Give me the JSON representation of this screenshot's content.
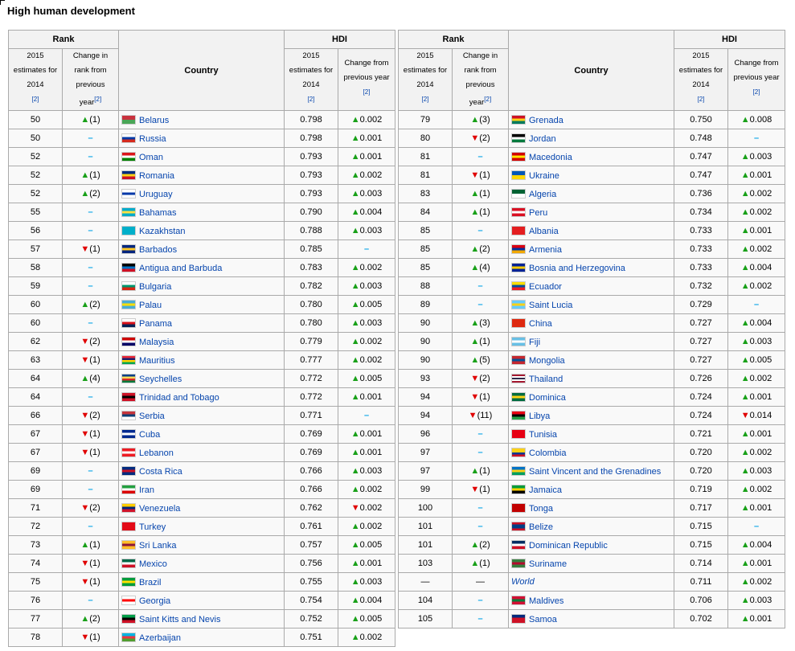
{
  "heading": "High human development",
  "header": {
    "rank": "Rank",
    "hdi": "HDI",
    "country": "Country",
    "estimates": "2015 estimates for 2014",
    "rank_change": "Change in rank from previous year",
    "hdi_change": "Change from previous year",
    "ref": "[2]"
  },
  "left_rows": [
    {
      "rank": "50",
      "rank_change": {
        "dir": "up",
        "value": "(1)"
      },
      "country": "Belarus",
      "flag": [
        "#c8313e",
        "#4aa657"
      ],
      "hdi": "0.798",
      "hdi_change": {
        "dir": "up",
        "value": "0.002"
      }
    },
    {
      "rank": "50",
      "rank_change": {
        "dir": "same",
        "value": ""
      },
      "country": "Russia",
      "flag": [
        "#ffffff",
        "#0039a6",
        "#d52b1e"
      ],
      "hdi": "0.798",
      "hdi_change": {
        "dir": "up",
        "value": "0.001"
      }
    },
    {
      "rank": "52",
      "rank_change": {
        "dir": "same",
        "value": ""
      },
      "country": "Oman",
      "flag": [
        "#db161b",
        "#ffffff",
        "#008000"
      ],
      "hdi": "0.793",
      "hdi_change": {
        "dir": "up",
        "value": "0.001"
      }
    },
    {
      "rank": "52",
      "rank_change": {
        "dir": "up",
        "value": "(1)"
      },
      "country": "Romania",
      "flag": [
        "#002b7f",
        "#fcd116",
        "#ce1126"
      ],
      "hdi": "0.793",
      "hdi_change": {
        "dir": "up",
        "value": "0.002"
      }
    },
    {
      "rank": "52",
      "rank_change": {
        "dir": "up",
        "value": "(2)"
      },
      "country": "Uruguay",
      "flag": [
        "#ffffff",
        "#0038a8",
        "#ffffff"
      ],
      "hdi": "0.793",
      "hdi_change": {
        "dir": "up",
        "value": "0.003"
      }
    },
    {
      "rank": "55",
      "rank_change": {
        "dir": "same",
        "value": ""
      },
      "country": "Bahamas",
      "flag": [
        "#00abc9",
        "#fae042",
        "#00abc9"
      ],
      "hdi": "0.790",
      "hdi_change": {
        "dir": "up",
        "value": "0.004"
      }
    },
    {
      "rank": "56",
      "rank_change": {
        "dir": "same",
        "value": ""
      },
      "country": "Kazakhstan",
      "flag": [
        "#00afca",
        "#00afca"
      ],
      "hdi": "0.788",
      "hdi_change": {
        "dir": "up",
        "value": "0.003"
      }
    },
    {
      "rank": "57",
      "rank_change": {
        "dir": "down",
        "value": "(1)"
      },
      "country": "Barbados",
      "flag": [
        "#00267f",
        "#ffc726",
        "#00267f"
      ],
      "hdi": "0.785",
      "hdi_change": {
        "dir": "same",
        "value": ""
      }
    },
    {
      "rank": "58",
      "rank_change": {
        "dir": "same",
        "value": ""
      },
      "country": "Antigua and Barbuda",
      "flag": [
        "#000000",
        "#0072c6",
        "#ce1126"
      ],
      "hdi": "0.783",
      "hdi_change": {
        "dir": "up",
        "value": "0.002"
      }
    },
    {
      "rank": "59",
      "rank_change": {
        "dir": "same",
        "value": ""
      },
      "country": "Bulgaria",
      "flag": [
        "#ffffff",
        "#00966e",
        "#d62612"
      ],
      "hdi": "0.782",
      "hdi_change": {
        "dir": "up",
        "value": "0.003"
      }
    },
    {
      "rank": "60",
      "rank_change": {
        "dir": "up",
        "value": "(2)"
      },
      "country": "Palau",
      "flag": [
        "#4aadd6",
        "#ffde00",
        "#4aadd6"
      ],
      "hdi": "0.780",
      "hdi_change": {
        "dir": "up",
        "value": "0.005"
      }
    },
    {
      "rank": "60",
      "rank_change": {
        "dir": "same",
        "value": ""
      },
      "country": "Panama",
      "flag": [
        "#ffffff",
        "#da121a",
        "#072357"
      ],
      "hdi": "0.780",
      "hdi_change": {
        "dir": "up",
        "value": "0.003"
      }
    },
    {
      "rank": "62",
      "rank_change": {
        "dir": "down",
        "value": "(2)"
      },
      "country": "Malaysia",
      "flag": [
        "#cc0001",
        "#ffffff",
        "#010066"
      ],
      "hdi": "0.779",
      "hdi_change": {
        "dir": "up",
        "value": "0.002"
      }
    },
    {
      "rank": "63",
      "rank_change": {
        "dir": "down",
        "value": "(1)"
      },
      "country": "Mauritius",
      "flag": [
        "#ea2839",
        "#1a206d",
        "#ffd500",
        "#00a551"
      ],
      "hdi": "0.777",
      "hdi_change": {
        "dir": "up",
        "value": "0.002"
      }
    },
    {
      "rank": "64",
      "rank_change": {
        "dir": "up",
        "value": "(4)"
      },
      "country": "Seychelles",
      "flag": [
        "#003f87",
        "#fcd856",
        "#d62828",
        "#007a3d"
      ],
      "hdi": "0.772",
      "hdi_change": {
        "dir": "up",
        "value": "0.005"
      }
    },
    {
      "rank": "64",
      "rank_change": {
        "dir": "same",
        "value": ""
      },
      "country": "Trinidad and Tobago",
      "flag": [
        "#ce1126",
        "#000000",
        "#ce1126"
      ],
      "hdi": "0.772",
      "hdi_change": {
        "dir": "up",
        "value": "0.001"
      }
    },
    {
      "rank": "66",
      "rank_change": {
        "dir": "down",
        "value": "(2)"
      },
      "country": "Serbia",
      "flag": [
        "#c6363c",
        "#0c4076",
        "#ffffff"
      ],
      "hdi": "0.771",
      "hdi_change": {
        "dir": "same",
        "value": ""
      }
    },
    {
      "rank": "67",
      "rank_change": {
        "dir": "down",
        "value": "(1)"
      },
      "country": "Cuba",
      "flag": [
        "#002a8f",
        "#ffffff",
        "#002a8f"
      ],
      "hdi": "0.769",
      "hdi_change": {
        "dir": "up",
        "value": "0.001"
      }
    },
    {
      "rank": "67",
      "rank_change": {
        "dir": "down",
        "value": "(1)"
      },
      "country": "Lebanon",
      "flag": [
        "#ed1c24",
        "#ffffff",
        "#ed1c24"
      ],
      "hdi": "0.769",
      "hdi_change": {
        "dir": "up",
        "value": "0.001"
      }
    },
    {
      "rank": "69",
      "rank_change": {
        "dir": "same",
        "value": ""
      },
      "country": "Costa Rica",
      "flag": [
        "#002b7f",
        "#ce1126",
        "#002b7f"
      ],
      "hdi": "0.766",
      "hdi_change": {
        "dir": "up",
        "value": "0.003"
      }
    },
    {
      "rank": "69",
      "rank_change": {
        "dir": "same",
        "value": ""
      },
      "country": "Iran",
      "flag": [
        "#239f40",
        "#ffffff",
        "#da0000"
      ],
      "hdi": "0.766",
      "hdi_change": {
        "dir": "up",
        "value": "0.002"
      }
    },
    {
      "rank": "71",
      "rank_change": {
        "dir": "down",
        "value": "(2)"
      },
      "country": "Venezuela",
      "flag": [
        "#ffcc00",
        "#00247d",
        "#cf142b"
      ],
      "hdi": "0.762",
      "hdi_change": {
        "dir": "down",
        "value": "0.002"
      }
    },
    {
      "rank": "72",
      "rank_change": {
        "dir": "same",
        "value": ""
      },
      "country": "Turkey",
      "flag": [
        "#e30a17",
        "#e30a17"
      ],
      "hdi": "0.761",
      "hdi_change": {
        "dir": "up",
        "value": "0.002"
      }
    },
    {
      "rank": "73",
      "rank_change": {
        "dir": "up",
        "value": "(1)"
      },
      "country": "Sri Lanka",
      "flag": [
        "#ffbe29",
        "#8d153a",
        "#ffbe29"
      ],
      "hdi": "0.757",
      "hdi_change": {
        "dir": "up",
        "value": "0.005"
      }
    },
    {
      "rank": "74",
      "rank_change": {
        "dir": "down",
        "value": "(1)"
      },
      "country": "Mexico",
      "flag": [
        "#006847",
        "#ffffff",
        "#ce1126"
      ],
      "hdi": "0.756",
      "hdi_change": {
        "dir": "up",
        "value": "0.001"
      }
    },
    {
      "rank": "75",
      "rank_change": {
        "dir": "down",
        "value": "(1)"
      },
      "country": "Brazil",
      "flag": [
        "#009c3b",
        "#ffdf00",
        "#009c3b"
      ],
      "hdi": "0.755",
      "hdi_change": {
        "dir": "up",
        "value": "0.003"
      }
    },
    {
      "rank": "76",
      "rank_change": {
        "dir": "same",
        "value": ""
      },
      "country": "Georgia",
      "flag": [
        "#ffffff",
        "#ff0000",
        "#ffffff"
      ],
      "hdi": "0.754",
      "hdi_change": {
        "dir": "up",
        "value": "0.004"
      }
    },
    {
      "rank": "77",
      "rank_change": {
        "dir": "up",
        "value": "(2)"
      },
      "country": "Saint Kitts and Nevis",
      "flag": [
        "#009e49",
        "#000000",
        "#ce1126"
      ],
      "hdi": "0.752",
      "hdi_change": {
        "dir": "up",
        "value": "0.005"
      }
    },
    {
      "rank": "78",
      "rank_change": {
        "dir": "down",
        "value": "(1)"
      },
      "country": "Azerbaijan",
      "flag": [
        "#00b5e2",
        "#ef3340",
        "#509e2f"
      ],
      "hdi": "0.751",
      "hdi_change": {
        "dir": "up",
        "value": "0.002"
      }
    }
  ],
  "right_rows": [
    {
      "rank": "79",
      "rank_change": {
        "dir": "up",
        "value": "(3)"
      },
      "country": "Grenada",
      "flag": [
        "#ce1126",
        "#fcd116",
        "#007a5e"
      ],
      "hdi": "0.750",
      "hdi_change": {
        "dir": "up",
        "value": "0.008"
      }
    },
    {
      "rank": "80",
      "rank_change": {
        "dir": "down",
        "value": "(2)"
      },
      "country": "Jordan",
      "flag": [
        "#000000",
        "#ffffff",
        "#007a3d"
      ],
      "hdi": "0.748",
      "hdi_change": {
        "dir": "same",
        "value": ""
      }
    },
    {
      "rank": "81",
      "rank_change": {
        "dir": "same",
        "value": ""
      },
      "country": "Macedonia",
      "flag": [
        "#d20000",
        "#ffe600",
        "#d20000"
      ],
      "hdi": "0.747",
      "hdi_change": {
        "dir": "up",
        "value": "0.003"
      }
    },
    {
      "rank": "81",
      "rank_change": {
        "dir": "down",
        "value": "(1)"
      },
      "country": "Ukraine",
      "flag": [
        "#0057b7",
        "#ffd700"
      ],
      "hdi": "0.747",
      "hdi_change": {
        "dir": "up",
        "value": "0.001"
      }
    },
    {
      "rank": "83",
      "rank_change": {
        "dir": "up",
        "value": "(1)"
      },
      "country": "Algeria",
      "flag": [
        "#006233",
        "#ffffff"
      ],
      "hdi": "0.736",
      "hdi_change": {
        "dir": "up",
        "value": "0.002"
      }
    },
    {
      "rank": "84",
      "rank_change": {
        "dir": "up",
        "value": "(1)"
      },
      "country": "Peru",
      "flag": [
        "#d91023",
        "#ffffff",
        "#d91023"
      ],
      "hdi": "0.734",
      "hdi_change": {
        "dir": "up",
        "value": "0.002"
      }
    },
    {
      "rank": "85",
      "rank_change": {
        "dir": "same",
        "value": ""
      },
      "country": "Albania",
      "flag": [
        "#e41e20",
        "#e41e20"
      ],
      "hdi": "0.733",
      "hdi_change": {
        "dir": "up",
        "value": "0.001"
      }
    },
    {
      "rank": "85",
      "rank_change": {
        "dir": "up",
        "value": "(2)"
      },
      "country": "Armenia",
      "flag": [
        "#d90012",
        "#0033a0",
        "#f2a800"
      ],
      "hdi": "0.733",
      "hdi_change": {
        "dir": "up",
        "value": "0.002"
      }
    },
    {
      "rank": "85",
      "rank_change": {
        "dir": "up",
        "value": "(4)"
      },
      "country": "Bosnia and Herzegovina",
      "flag": [
        "#002395",
        "#fecb00",
        "#002395"
      ],
      "hdi": "0.733",
      "hdi_change": {
        "dir": "up",
        "value": "0.004"
      }
    },
    {
      "rank": "88",
      "rank_change": {
        "dir": "same",
        "value": ""
      },
      "country": "Ecuador",
      "flag": [
        "#ffdd00",
        "#034ea2",
        "#ed1c24"
      ],
      "hdi": "0.732",
      "hdi_change": {
        "dir": "up",
        "value": "0.002"
      }
    },
    {
      "rank": "89",
      "rank_change": {
        "dir": "same",
        "value": ""
      },
      "country": "Saint Lucia",
      "flag": [
        "#66ccff",
        "#fcd116",
        "#66ccff"
      ],
      "hdi": "0.729",
      "hdi_change": {
        "dir": "same",
        "value": ""
      }
    },
    {
      "rank": "90",
      "rank_change": {
        "dir": "up",
        "value": "(3)"
      },
      "country": "China",
      "flag": [
        "#de2910",
        "#de2910"
      ],
      "hdi": "0.727",
      "hdi_change": {
        "dir": "up",
        "value": "0.004"
      }
    },
    {
      "rank": "90",
      "rank_change": {
        "dir": "up",
        "value": "(1)"
      },
      "country": "Fiji",
      "flag": [
        "#68bfe5",
        "#ffffff",
        "#68bfe5"
      ],
      "hdi": "0.727",
      "hdi_change": {
        "dir": "up",
        "value": "0.003"
      }
    },
    {
      "rank": "90",
      "rank_change": {
        "dir": "up",
        "value": "(5)"
      },
      "country": "Mongolia",
      "flag": [
        "#c4272f",
        "#015197",
        "#c4272f"
      ],
      "hdi": "0.727",
      "hdi_change": {
        "dir": "up",
        "value": "0.005"
      }
    },
    {
      "rank": "93",
      "rank_change": {
        "dir": "down",
        "value": "(2)"
      },
      "country": "Thailand",
      "flag": [
        "#a51931",
        "#ffffff",
        "#2d2a4a",
        "#ffffff",
        "#a51931"
      ],
      "hdi": "0.726",
      "hdi_change": {
        "dir": "up",
        "value": "0.002"
      }
    },
    {
      "rank": "94",
      "rank_change": {
        "dir": "down",
        "value": "(1)"
      },
      "country": "Dominica",
      "flag": [
        "#006b3f",
        "#fcd116",
        "#006b3f"
      ],
      "hdi": "0.724",
      "hdi_change": {
        "dir": "up",
        "value": "0.001"
      }
    },
    {
      "rank": "94",
      "rank_change": {
        "dir": "down",
        "value": "(11)"
      },
      "country": "Libya",
      "flag": [
        "#e70013",
        "#000000",
        "#239e46"
      ],
      "hdi": "0.724",
      "hdi_change": {
        "dir": "down",
        "value": "0.014"
      }
    },
    {
      "rank": "96",
      "rank_change": {
        "dir": "same",
        "value": ""
      },
      "country": "Tunisia",
      "flag": [
        "#e70013",
        "#e70013"
      ],
      "hdi": "0.721",
      "hdi_change": {
        "dir": "up",
        "value": "0.001"
      }
    },
    {
      "rank": "97",
      "rank_change": {
        "dir": "same",
        "value": ""
      },
      "country": "Colombia",
      "flag": [
        "#fcd116",
        "#fcd116",
        "#003893",
        "#ce1126"
      ],
      "hdi": "0.720",
      "hdi_change": {
        "dir": "up",
        "value": "0.002"
      }
    },
    {
      "rank": "97",
      "rank_change": {
        "dir": "up",
        "value": "(1)"
      },
      "country": "Saint Vincent and the Grenadines",
      "flag": [
        "#0072c6",
        "#fcd116",
        "#009e60"
      ],
      "hdi": "0.720",
      "hdi_change": {
        "dir": "up",
        "value": "0.003"
      }
    },
    {
      "rank": "99",
      "rank_change": {
        "dir": "down",
        "value": "(1)"
      },
      "country": "Jamaica",
      "flag": [
        "#009b3a",
        "#fed100",
        "#000000"
      ],
      "hdi": "0.719",
      "hdi_change": {
        "dir": "up",
        "value": "0.002"
      }
    },
    {
      "rank": "100",
      "rank_change": {
        "dir": "same",
        "value": ""
      },
      "country": "Tonga",
      "flag": [
        "#c10000",
        "#c10000"
      ],
      "hdi": "0.717",
      "hdi_change": {
        "dir": "up",
        "value": "0.001"
      }
    },
    {
      "rank": "101",
      "rank_change": {
        "dir": "same",
        "value": ""
      },
      "country": "Belize",
      "flag": [
        "#ce1126",
        "#003f87",
        "#003f87",
        "#ce1126"
      ],
      "hdi": "0.715",
      "hdi_change": {
        "dir": "same",
        "value": ""
      }
    },
    {
      "rank": "101",
      "rank_change": {
        "dir": "up",
        "value": "(2)"
      },
      "country": "Dominican Republic",
      "flag": [
        "#002d62",
        "#ffffff",
        "#ce1126"
      ],
      "hdi": "0.715",
      "hdi_change": {
        "dir": "up",
        "value": "0.004"
      }
    },
    {
      "rank": "103",
      "rank_change": {
        "dir": "up",
        "value": "(1)"
      },
      "country": "Suriname",
      "flag": [
        "#377e3f",
        "#b40a2d",
        "#377e3f"
      ],
      "hdi": "0.714",
      "hdi_change": {
        "dir": "up",
        "value": "0.001"
      }
    },
    {
      "rank": "—",
      "rank_change": {
        "dir": "text",
        "value": "—"
      },
      "country": "World",
      "world": true,
      "flag": [],
      "hdi": "0.711",
      "hdi_change": {
        "dir": "up",
        "value": "0.002"
      }
    },
    {
      "rank": "104",
      "rank_change": {
        "dir": "same",
        "value": ""
      },
      "country": "Maldives",
      "flag": [
        "#d21034",
        "#007e3a",
        "#d21034"
      ],
      "hdi": "0.706",
      "hdi_change": {
        "dir": "up",
        "value": "0.003"
      }
    },
    {
      "rank": "105",
      "rank_change": {
        "dir": "same",
        "value": ""
      },
      "country": "Samoa",
      "flag": [
        "#002b7f",
        "#ce1126",
        "#ce1126"
      ],
      "hdi": "0.702",
      "hdi_change": {
        "dir": "up",
        "value": "0.001"
      }
    }
  ],
  "colors": {
    "up": "#19a019",
    "down": "#e00000",
    "same": "#0aa5e8",
    "link": "#0645ad"
  }
}
